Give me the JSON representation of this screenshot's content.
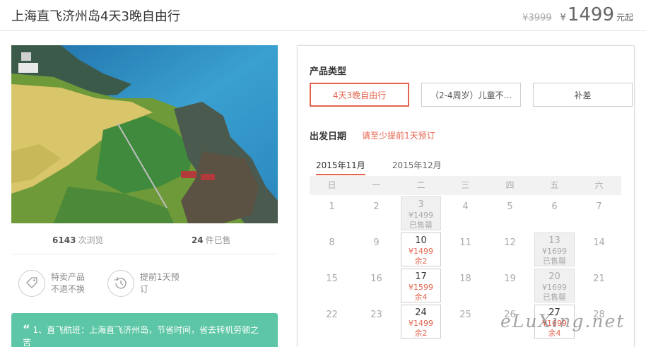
{
  "header": {
    "title": "上海直飞济州岛4天3晚自由行",
    "old_price": "¥3999",
    "currency": "¥",
    "price": "1499",
    "price_unit": "元起"
  },
  "stats": {
    "views_count": "6143",
    "views_label": "次浏览",
    "sold_count": "24",
    "sold_label": "件已售"
  },
  "badges": [
    {
      "icon": "tag-icon",
      "line1": "特卖产品",
      "line2": "不退不换"
    },
    {
      "icon": "clock-icon",
      "line1": "提前1天预",
      "line2": "订"
    }
  ],
  "highlight": {
    "quote": "“",
    "text": "1、直飞航班：上海直飞济州岛，节省时间，省去转机劳顿之苦"
  },
  "booking": {
    "type_label": "产品类型",
    "types": [
      "4天3晚自由行",
      "（2-4周岁）儿童不...",
      "补差"
    ],
    "date_label": "出发日期",
    "date_note": "请至少提前1天预订",
    "months": [
      "2015年11月",
      "2015年12月"
    ],
    "weekdays": [
      "日",
      "一",
      "二",
      "三",
      "四",
      "五",
      "六"
    ],
    "weeks": [
      [
        {
          "day": "1"
        },
        {
          "day": "2"
        },
        {
          "day": "3",
          "price": "¥1499",
          "status": "已售罄",
          "soldout": true
        },
        {
          "day": "4"
        },
        {
          "day": "5"
        },
        {
          "day": "6"
        },
        {
          "day": "7"
        }
      ],
      [
        {
          "day": "8"
        },
        {
          "day": "9"
        },
        {
          "day": "10",
          "price": "¥1499",
          "status": "余2"
        },
        {
          "day": "11"
        },
        {
          "day": "12"
        },
        {
          "day": "13",
          "price": "¥1699",
          "status": "已售罄",
          "soldout": true
        },
        {
          "day": "14"
        }
      ],
      [
        {
          "day": "15"
        },
        {
          "day": "16"
        },
        {
          "day": "17",
          "price": "¥1599",
          "status": "余4"
        },
        {
          "day": "18"
        },
        {
          "day": "19"
        },
        {
          "day": "20",
          "price": "¥1699",
          "status": "已售罄",
          "soldout": true
        },
        {
          "day": "21"
        }
      ],
      [
        {
          "day": "22"
        },
        {
          "day": "23"
        },
        {
          "day": "24",
          "price": "¥1499",
          "status": "余2"
        },
        {
          "day": "25"
        },
        {
          "day": "26"
        },
        {
          "day": "27",
          "price": "¥1699",
          "status": "余4"
        },
        {
          "day": "28"
        }
      ]
    ]
  },
  "watermark": "eLuXing.net",
  "colors": {
    "accent": "#e4644f",
    "green": "#5cc6a6"
  }
}
